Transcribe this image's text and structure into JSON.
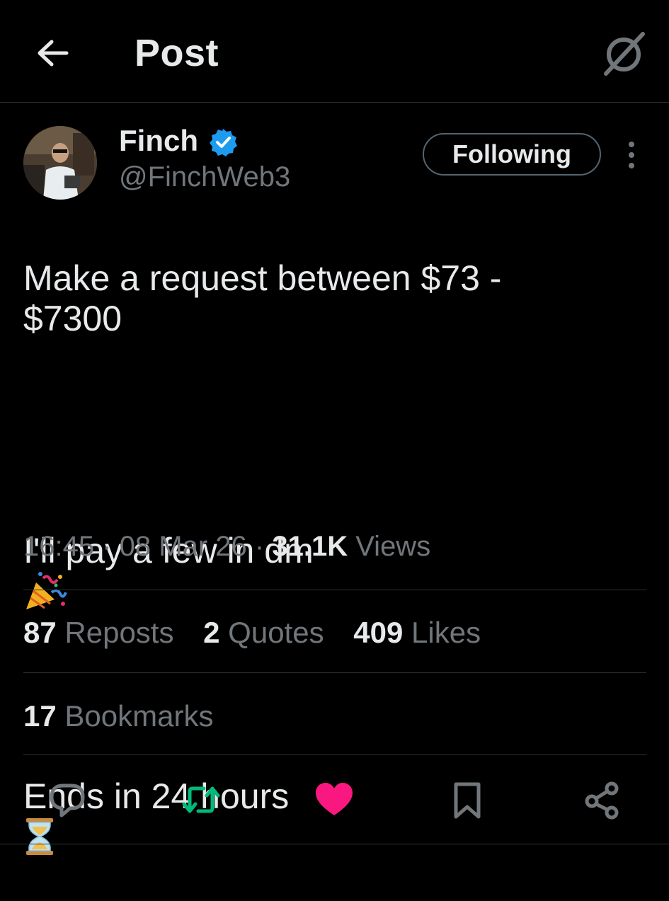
{
  "header": {
    "title": "Post",
    "back_icon": "arrow-left-icon",
    "grok_icon": "grok-icon"
  },
  "author": {
    "name": "Finch",
    "handle": "@FinchWeb3",
    "verified": true,
    "follow_label": "Following"
  },
  "tweet": {
    "line1": "Make a request between $73 - $7300",
    "line2": "I'll pay a few in dm",
    "line3": "Ends in 24 hours"
  },
  "meta": {
    "time": "16:45",
    "date": "08 Mar 26",
    "views_count": "31.1K",
    "views_label": "Views"
  },
  "stats": {
    "reposts": {
      "count": "87",
      "label": "Reposts"
    },
    "quotes": {
      "count": "2",
      "label": "Quotes"
    },
    "likes": {
      "count": "409",
      "label": "Likes"
    },
    "bookmarks": {
      "count": "17",
      "label": "Bookmarks"
    }
  },
  "actions": [
    "reply-icon",
    "repost-icon",
    "like-icon",
    "bookmark-icon",
    "share-icon"
  ],
  "colors": {
    "background": "#000000",
    "text": "#e7e9ea",
    "muted": "#71767b",
    "verified": "#1d9bf0",
    "repost_active": "#00ba7c",
    "like_active": "#f91880",
    "divider": "#2f3336"
  }
}
